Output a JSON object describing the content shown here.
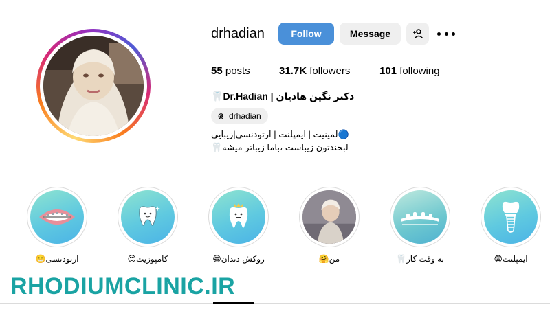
{
  "profile": {
    "username": "drhadian",
    "follow_label": "Follow",
    "message_label": "Message",
    "stats": {
      "posts_count": "55",
      "posts_label": "posts",
      "followers_count": "31.7K",
      "followers_label": "followers",
      "following_count": "101",
      "following_label": "following"
    },
    "full_name": "دکتر نگین هادیان | Dr.Hadian🦷",
    "threads_handle": "drhadian",
    "bio_lines": [
      "🔵لمینیت | ایمپلنت | ارتودنسی|زیبایی",
      "لبخندتون زیباست ،باما زیباتر میشه🦷"
    ]
  },
  "highlights": [
    {
      "label": "ارتودنسی😬",
      "icon": "braces-teeth-icon"
    },
    {
      "label": "کامپوزیت😍",
      "icon": "tooth-sparkle-icon"
    },
    {
      "label": "روکش دندان😁",
      "icon": "crown-tooth-icon"
    },
    {
      "label": "من🤗",
      "icon": "photo-portrait"
    },
    {
      "label": "به وقت کار🦷",
      "icon": "dental-tools-icon"
    },
    {
      "label": "ایمپلنت😨",
      "icon": "implant-icon"
    }
  ],
  "watermark": "RHODIUMCLINIC.IR",
  "colors": {
    "follow_button": "#4a90d9",
    "secondary_button": "#efefef",
    "watermark": "#1aa3a3",
    "highlight_gradient_start": "#8ee3d0",
    "highlight_gradient_end": "#4bb3e6"
  }
}
